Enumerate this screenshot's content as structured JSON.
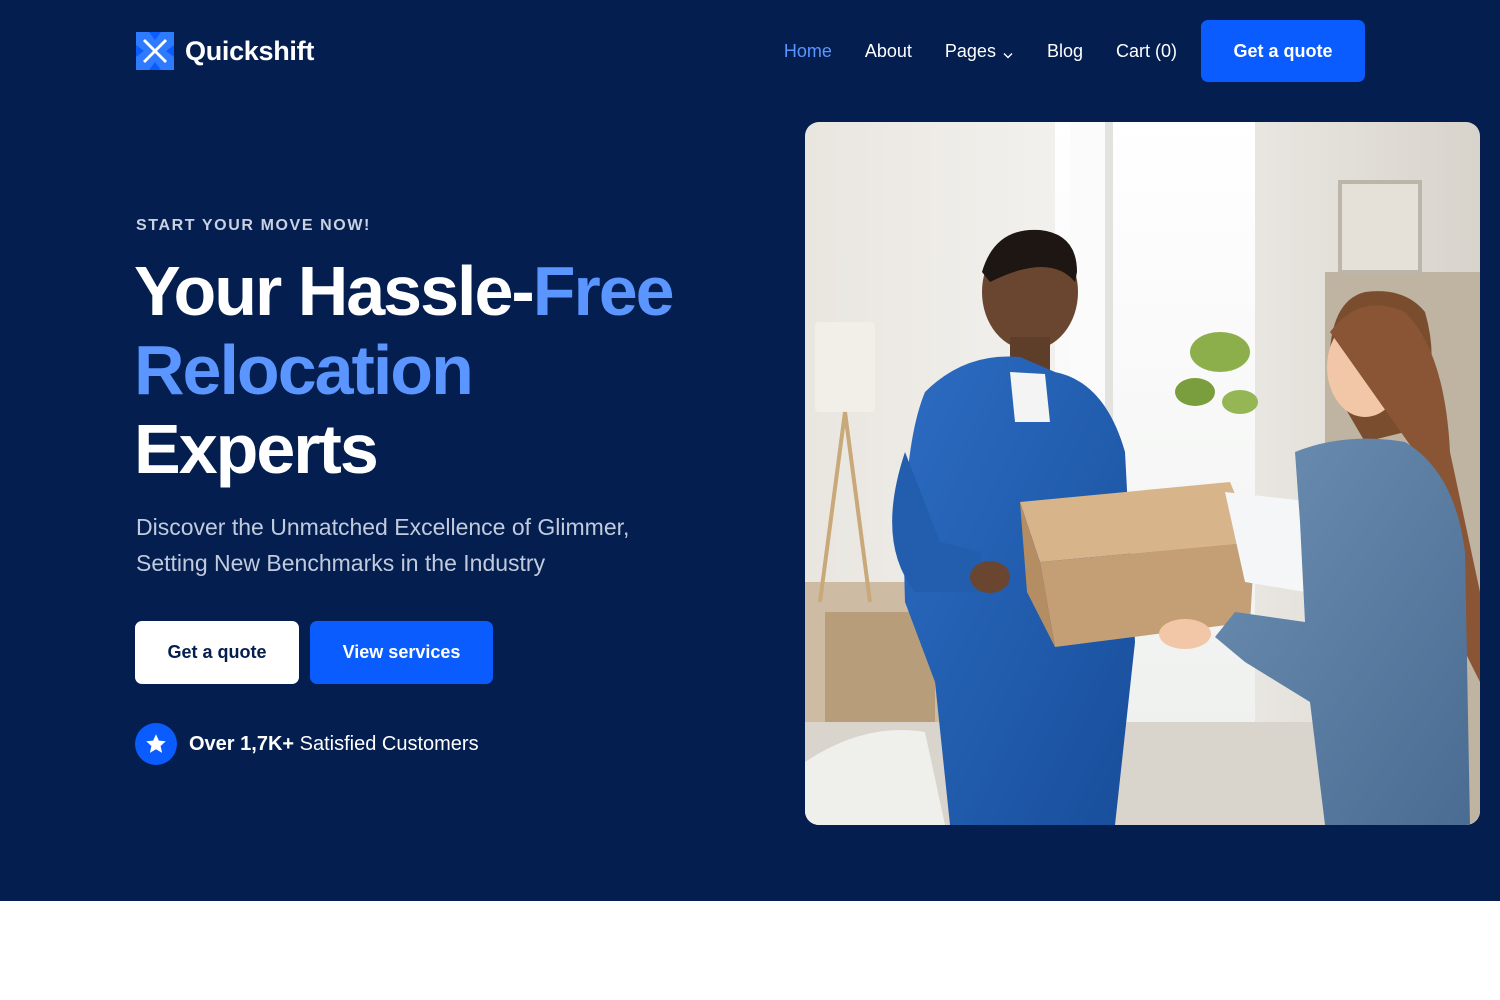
{
  "brand": {
    "name": "Quickshift"
  },
  "nav": {
    "items": [
      {
        "label": "Home",
        "active": true
      },
      {
        "label": "About"
      },
      {
        "label": "Pages",
        "has_dropdown": true
      },
      {
        "label": "Blog"
      },
      {
        "label": "Cart (0)"
      }
    ],
    "cta_label": "Get a quote"
  },
  "hero": {
    "eyebrow": "START YOUR MOVE NOW!",
    "headline": {
      "part1": "Your Hassle-",
      "part2_accent": "Free",
      "part3_accent": "Relocation",
      "part4": "Experts"
    },
    "subtext_line1": "Discover the Unmatched Excellence of Glimmer,",
    "subtext_line2": "Setting New Benchmarks in the Industry",
    "primary_button": "Get a quote",
    "secondary_button": "View services",
    "proof_bold": "Over 1,7K+",
    "proof_text": " Satisfied Customers",
    "image_icon": "mover-handing-box-photo"
  },
  "colors": {
    "hero_background": "#031e4f",
    "accent_blue": "#0a5cff",
    "accent_text_blue": "#5b95ff",
    "white": "#ffffff"
  }
}
